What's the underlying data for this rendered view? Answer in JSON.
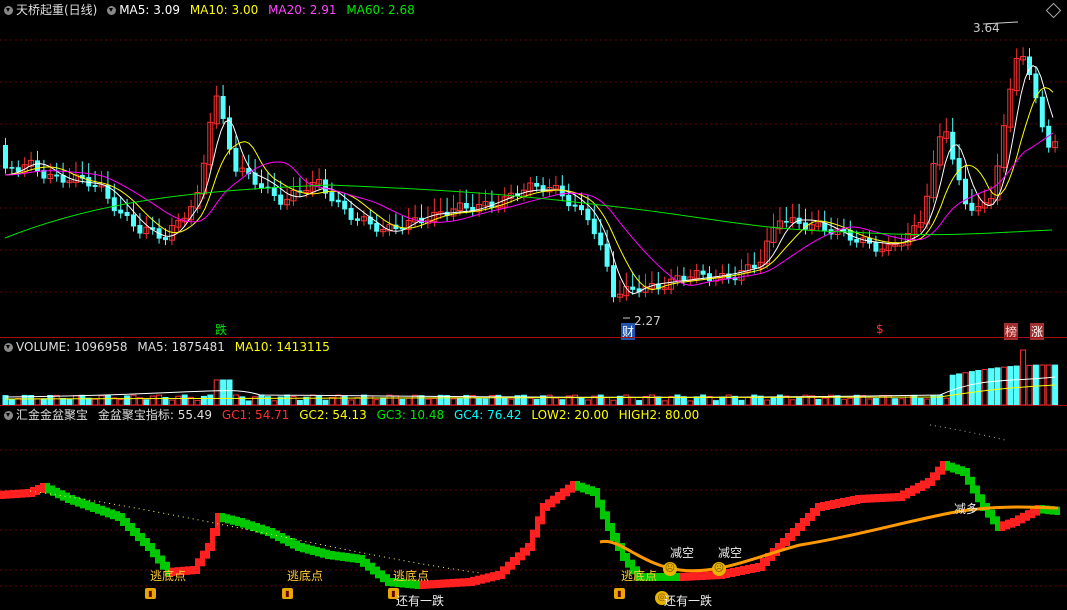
{
  "price_header": {
    "name": "天桥起重(日线)",
    "ma5": "MA5: 3.09",
    "ma10": "MA10: 3.00",
    "ma20": "MA20: 2.91",
    "ma60": "MA60: 2.68"
  },
  "volume_header": {
    "volume": "VOLUME: 1096958",
    "ma5": "MA5: 1875481",
    "ma10": "MA10: 1413115"
  },
  "indicator_header": {
    "name": "汇金金盆聚宝",
    "title": "金盆聚宝指标: 55.49",
    "gc1": "GC1: 54.71",
    "gc2": "GC2: 54.13",
    "gc3": "GC3: 10.48",
    "gc4": "GC4: 76.42",
    "low2": "LOW2: 20.00",
    "high2": "HIGH2: 80.00"
  },
  "price_labels": {
    "high": "3.64",
    "low": "2.27",
    "event_fall": "跌",
    "event_cai": "财",
    "event_dollar": "$",
    "event_bang": "榜",
    "event_zhang": "涨"
  },
  "indicator_labels": {
    "escape1": "逃底点",
    "escape2": "逃底点",
    "escape3": "逃底点",
    "escape4": "逃底点",
    "reduce_short1": "减空",
    "reduce_short2": "减空",
    "reduce_long": "减多",
    "drop1": "还有一跌",
    "drop2": "还有一跌"
  },
  "colors": {
    "background": "#000000",
    "up": "#ff3232",
    "down": "#54ffff",
    "ma5": "#ffffff",
    "ma10": "#ffff00",
    "ma20": "#ff00ff",
    "ma60": "#00e600",
    "ind_up": "#ff2020",
    "ind_down": "#00c800",
    "ind_line": "#ff9900"
  }
}
